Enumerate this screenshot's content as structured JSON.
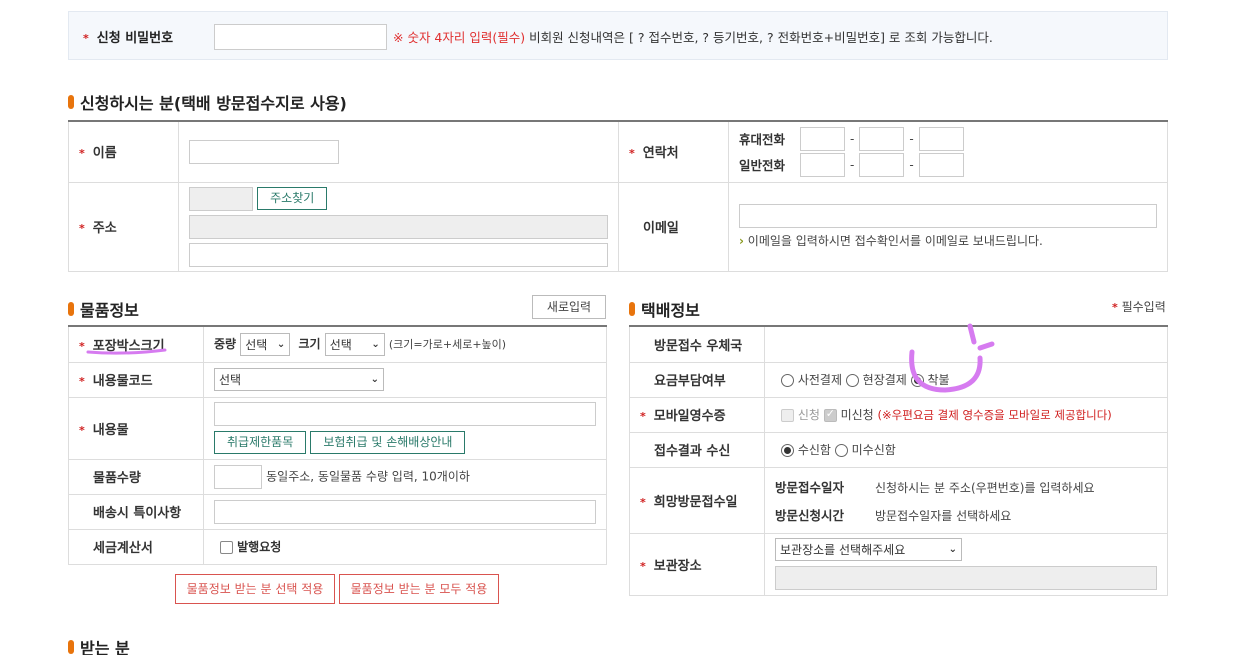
{
  "password": {
    "label": "신청 비밀번호",
    "hint_red": "※ 숫자 4자리 입력(필수)",
    "hint": " 비회원 신청내역은 [ ? 접수번호, ? 등기번호, ? 전화번호+비밀번호] 로 조회 가능합니다."
  },
  "applicant": {
    "title": "신청하시는 분(택배 방문접수지로 사용)",
    "name_label": "이름",
    "contact_label": "연락처",
    "mobile_label": "휴대전화",
    "phone_label": "일반전화",
    "dash": "-",
    "address_label": "주소",
    "find_address_button": "주소찾기",
    "email_label": "이메일",
    "email_note": "이메일을 입력하시면 접수확인서를 이메일로 보내드립니다."
  },
  "goods": {
    "title": "물품정보",
    "new_input_button": "새로입력",
    "box_size_label": "포장박스크기",
    "weight_label": "중량",
    "weight_select": "선택",
    "size_label": "크기",
    "size_select": "선택",
    "size_hint": "(크기=가로+세로+높이)",
    "content_code_label": "내용물코드",
    "content_code_select": "선택",
    "content_label": "내용물",
    "restricted_button": "취급제한품목",
    "insurance_button": "보험취급 및 손해배상안내",
    "quantity_label": "물품수량",
    "quantity_hint": "동일주소, 동일물품 수량 입력, 10개이하",
    "delivery_note_label": "배송시 특이사항",
    "tax_invoice_label": "세금계산서",
    "tax_invoice_check": "발행요청",
    "apply_selected_button": "물품정보 받는 분 선택 적용",
    "apply_all_button": "물품정보 받는 분 모두 적용"
  },
  "delivery": {
    "title": "택배정보",
    "required_note": "필수입력",
    "post_office_label": "방문접수 우체국",
    "fee_label": "요금부담여부",
    "fee_options": [
      "사전결제",
      "현장결제",
      "착불"
    ],
    "mobile_receipt_label": "모바일영수증",
    "receipt_apply": "신청",
    "receipt_not_apply": "미신청",
    "receipt_note": "(※우편요금 결제 영수증을 모바일로 제공합니다)",
    "result_label": "접수결과 수신",
    "result_options": [
      "수신함",
      "미수신함"
    ],
    "visit_date_label": "희망방문접수일",
    "visit_date_title": "방문접수일자",
    "visit_date_text": "신청하시는 분 주소(우편번호)를 입력하세요",
    "visit_time_title": "방문신청시간",
    "visit_time_text": "방문접수일자를 선택하세요",
    "storage_label": "보관장소",
    "storage_select": "보관장소를 선택해주세요"
  },
  "receiver": {
    "title": "받는 분"
  },
  "colors": {
    "accent": "#e8740c",
    "required": "#d02020",
    "button_teal": "#2a7a6a",
    "highlight": "#d67bf0"
  }
}
